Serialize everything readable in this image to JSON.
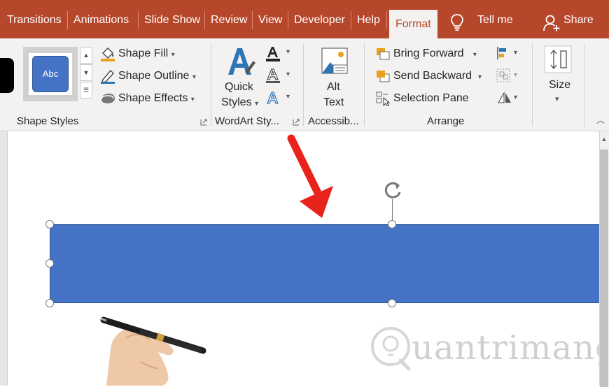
{
  "tabs": [
    "Transitions",
    "Animations",
    "Slide Show",
    "Review",
    "View",
    "Developer",
    "Help",
    "Format"
  ],
  "active_tab": "Format",
  "tell_me": "Tell me",
  "share": "Share",
  "shape_styles": {
    "swatch_label": "Abc",
    "fill": "Shape Fill",
    "outline": "Shape Outline",
    "effects": "Shape Effects",
    "group": "Shape Styles"
  },
  "wordart": {
    "quick_styles_1": "Quick",
    "quick_styles_2": "Styles",
    "group": "WordArt Sty..."
  },
  "accessibility": {
    "alt_1": "Alt",
    "alt_2": "Text",
    "group": "Accessib..."
  },
  "arrange": {
    "bring_forward": "Bring Forward",
    "send_backward": "Send Backward",
    "selection_pane": "Selection Pane",
    "group": "Arrange"
  },
  "size": {
    "label": "Size"
  },
  "watermark": "uantrimang",
  "colors": {
    "accent": "#b7472a",
    "shape_fill": "#4472c4",
    "arrow": "#e8231c"
  },
  "icons": [
    "lightbulb-icon",
    "person-icon",
    "shape-fill-icon",
    "shape-outline-icon",
    "shape-effects-icon",
    "wordart-a-icon",
    "alt-text-icon",
    "bring-forward-icon",
    "send-backward-icon",
    "selection-pane-icon",
    "align-icon",
    "group-icon",
    "rotate-icon",
    "size-icon",
    "rotation-handle-icon"
  ]
}
